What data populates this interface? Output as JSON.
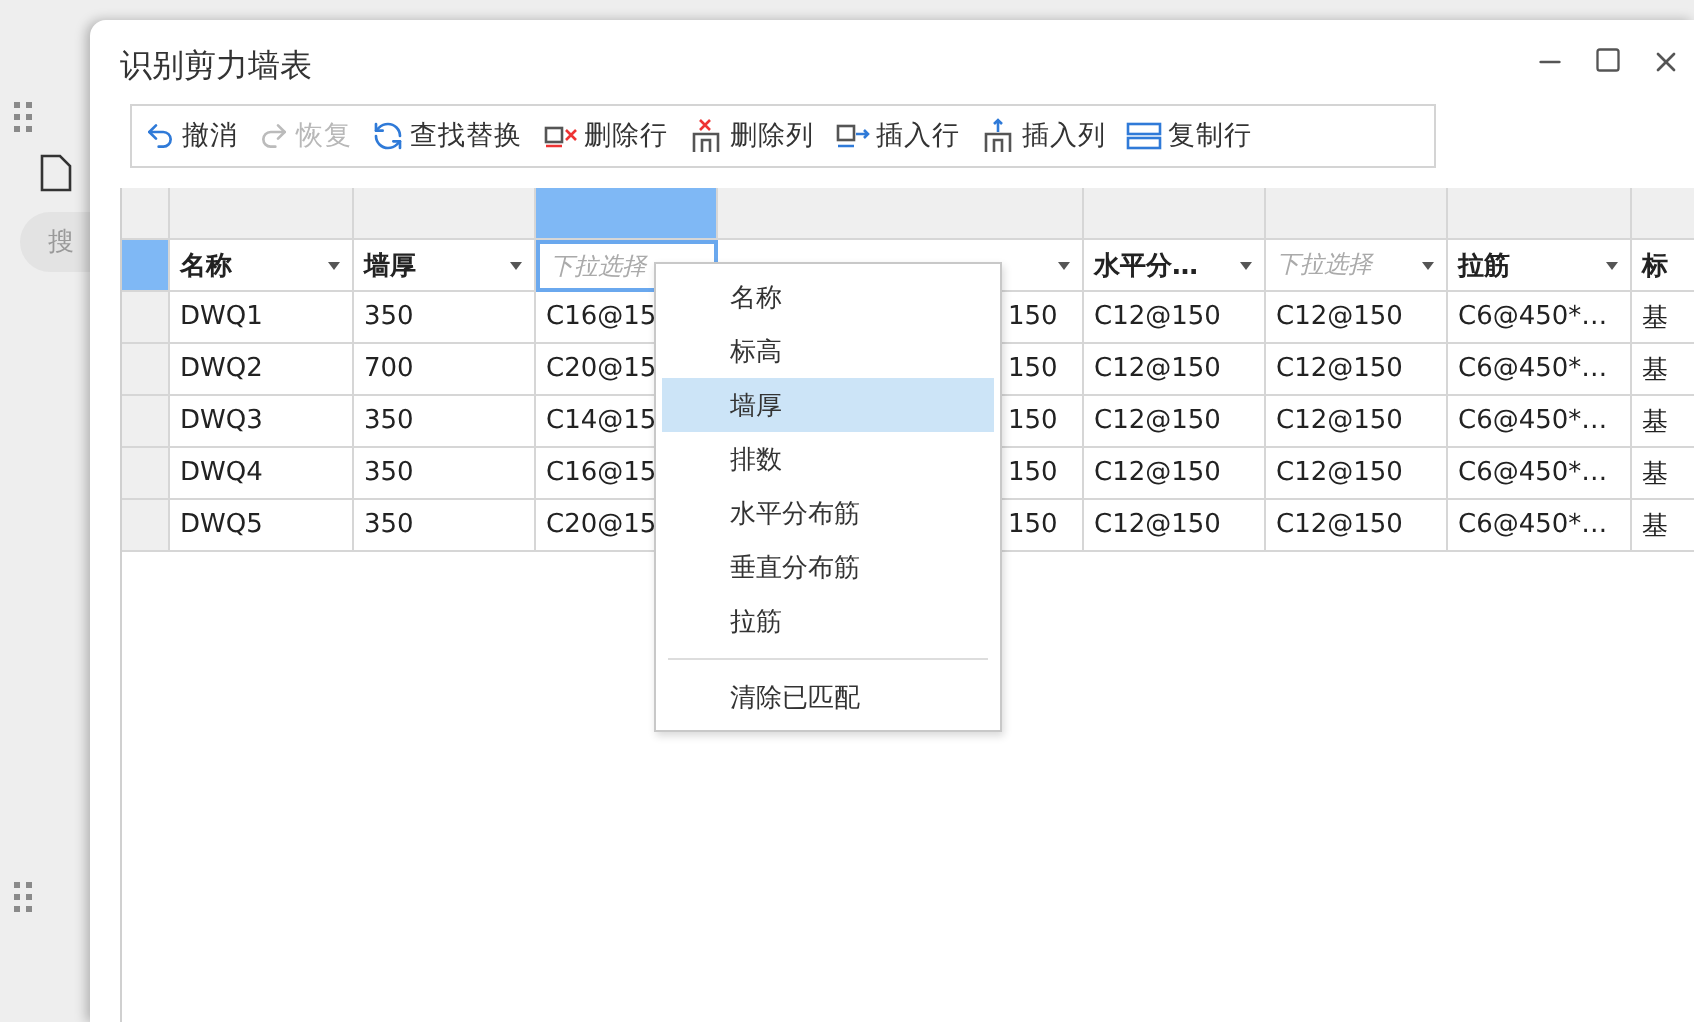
{
  "background_panel": {
    "search": {
      "placeholder": "搜"
    }
  },
  "window": {
    "title": "识别剪力墙表"
  },
  "toolbar": [
    {
      "kind": "undo",
      "label": "撤消",
      "disabled": false
    },
    {
      "kind": "redo",
      "label": "恢复",
      "disabled": true
    },
    {
      "kind": "replace",
      "label": "查找替换",
      "disabled": false
    },
    {
      "kind": "delete-row",
      "label": "删除行",
      "disabled": false
    },
    {
      "kind": "delete-column",
      "label": "删除列",
      "disabled": false
    },
    {
      "kind": "insert-row",
      "label": "插入行",
      "disabled": false
    },
    {
      "kind": "insert-column",
      "label": "插入列",
      "disabled": false
    },
    {
      "kind": "copy-row",
      "label": "复制行",
      "disabled": false
    }
  ],
  "table": {
    "columns": [
      {
        "kind": "header",
        "label": "名称",
        "dropdown": true,
        "selected": false
      },
      {
        "kind": "header",
        "label": "墙厚",
        "dropdown": true,
        "selected": false
      },
      {
        "kind": "select",
        "placeholder": "下拉选择",
        "dropdown": false,
        "selected": true
      },
      {
        "kind": "covered",
        "dropdown": true,
        "selected": false
      },
      {
        "kind": "header",
        "label": "水平分…",
        "dropdown": true,
        "selected": false
      },
      {
        "kind": "select",
        "placeholder": "下拉选择",
        "dropdown": true,
        "selected": false
      },
      {
        "kind": "header",
        "label": "拉筋",
        "dropdown": true,
        "selected": false
      },
      {
        "kind": "header",
        "label": "标",
        "dropdown": false,
        "selected": false
      }
    ],
    "rows": [
      {
        "cells": [
          "DWQ1",
          "350",
          "C16@15",
          "150",
          "C12@150",
          "C12@150",
          "C6@450*…",
          "基"
        ]
      },
      {
        "cells": [
          "DWQ2",
          "700",
          "C20@15",
          "150",
          "C12@150",
          "C12@150",
          "C6@450*…",
          "基"
        ]
      },
      {
        "cells": [
          "DWQ3",
          "350",
          "C14@15",
          "150",
          "C12@150",
          "C12@150",
          "C6@450*…",
          "基"
        ]
      },
      {
        "cells": [
          "DWQ4",
          "350",
          "C16@15",
          "150",
          "C12@150",
          "C12@150",
          "C6@450*…",
          "基"
        ]
      },
      {
        "cells": [
          "DWQ5",
          "350",
          "C20@15",
          "150",
          "C12@150",
          "C12@150",
          "C6@450*…",
          "基"
        ]
      }
    ]
  },
  "menu": {
    "items": [
      {
        "label": "名称",
        "selected": false
      },
      {
        "label": "标高",
        "selected": false
      },
      {
        "label": "墙厚",
        "selected": true
      },
      {
        "label": "排数",
        "selected": false
      },
      {
        "label": "水平分布筋",
        "selected": false
      },
      {
        "label": "垂直分布筋",
        "selected": false
      },
      {
        "label": "拉筋",
        "selected": false
      }
    ],
    "footer_items": [
      {
        "label": "清除已匹配",
        "selected": false
      }
    ]
  }
}
